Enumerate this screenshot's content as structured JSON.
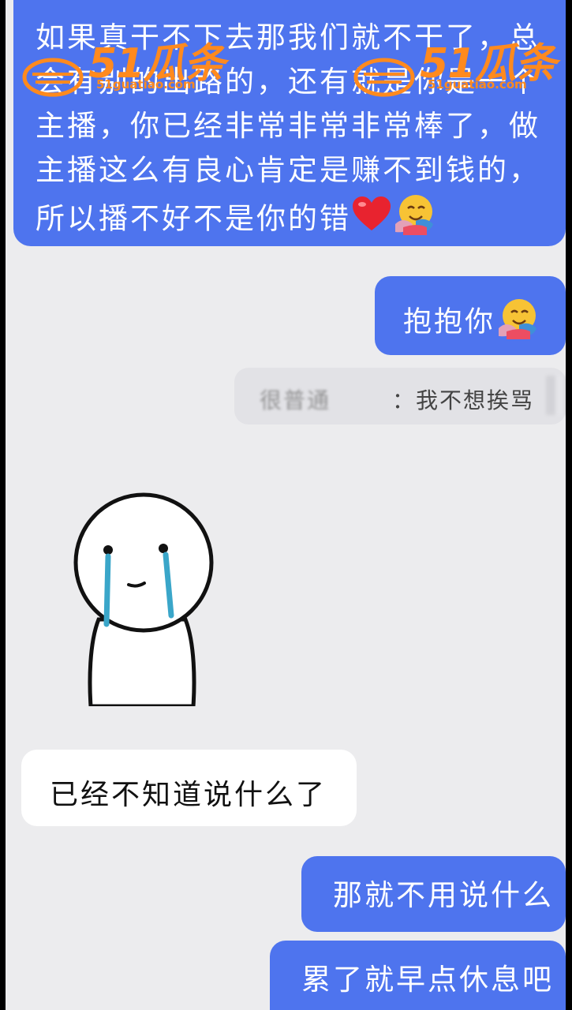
{
  "messages": {
    "top_text": "如果真干不下去那我们就不干了，总会有别的出路的，还有就是你是一个主播，你已经非常非常非常棒了，做主播这么有良心肯定是赚不到钱的，所以播不好不是你的错",
    "hug_text": "抱抱你",
    "quote_name": "很普通",
    "quote_text": "：我不想挨骂",
    "white_text": "已经不知道说什么了",
    "reply1": "那就不用说什么",
    "reply2": "累了就早点休息吧"
  },
  "watermark": {
    "brand": "51瓜条",
    "site": "51guatiao.com"
  },
  "colors": {
    "blue_bubble": "#4e74ee",
    "background": "#ececee",
    "watermark": "#ff8a1e"
  },
  "icons": [
    "heart-emoji",
    "hugging-face-emoji",
    "crying-stick-figure-sticker"
  ]
}
